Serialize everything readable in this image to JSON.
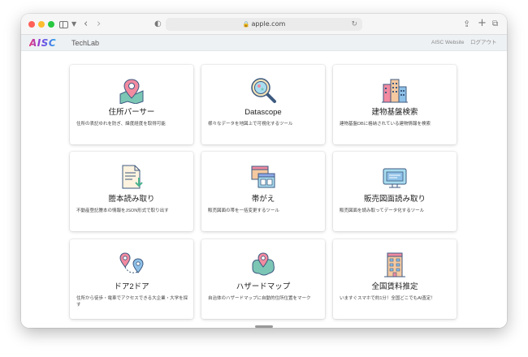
{
  "browser": {
    "url": "apple.com",
    "icons": [
      "sidebar-icon",
      "chevron-down-icon",
      "back-icon",
      "forward-icon",
      "shield-icon",
      "lock-icon",
      "reload-icon",
      "share-icon",
      "plus-icon",
      "tabs-icon"
    ]
  },
  "header": {
    "logo": "AISC",
    "app_name": "TechLab",
    "links": {
      "website": "AISC Website",
      "logout": "ログアウト"
    }
  },
  "cards": [
    {
      "title": "住所パーサー",
      "desc": "住所の表記ゆれを防ぎ、緯度経度を取得可能",
      "icon": "map-pin-icon"
    },
    {
      "title": "Datascope",
      "desc": "様々なデータを地図上で可視化するツール",
      "icon": "magnifier-icon"
    },
    {
      "title": "建物基盤検索",
      "desc": "建物基盤DBに格納されている建物情報を検索",
      "icon": "buildings-icon"
    },
    {
      "title": "謄本読み取り",
      "desc": "不動産登記謄本の情報をJSON形式で取り出す",
      "icon": "document-download-icon"
    },
    {
      "title": "帯がえ",
      "desc": "販売図面の帯を一括変更するツール",
      "icon": "layout-panels-icon"
    },
    {
      "title": "販売図面読み取り",
      "desc": "販売図面を読み取ってデータ化するツール",
      "icon": "monitor-icon"
    },
    {
      "title": "ドア2ドア",
      "desc": "住所から徒歩・電車でアクセスできる大企業・大学を探す",
      "icon": "route-pins-icon"
    },
    {
      "title": "ハザードマップ",
      "desc": "自治体のハザードマップに自動的住所位置をマーク",
      "icon": "hazard-map-icon"
    },
    {
      "title": "全国賃料推定",
      "desc": "いますぐスマホで約1分！全国どこでもAI査定！",
      "icon": "apartment-building-icon"
    }
  ],
  "colors": {
    "close": "#fe5f57",
    "minimize": "#febc2e",
    "maximize": "#28c840",
    "appbar_bg": "#eef1f4",
    "card_bg": "#ffffff"
  }
}
